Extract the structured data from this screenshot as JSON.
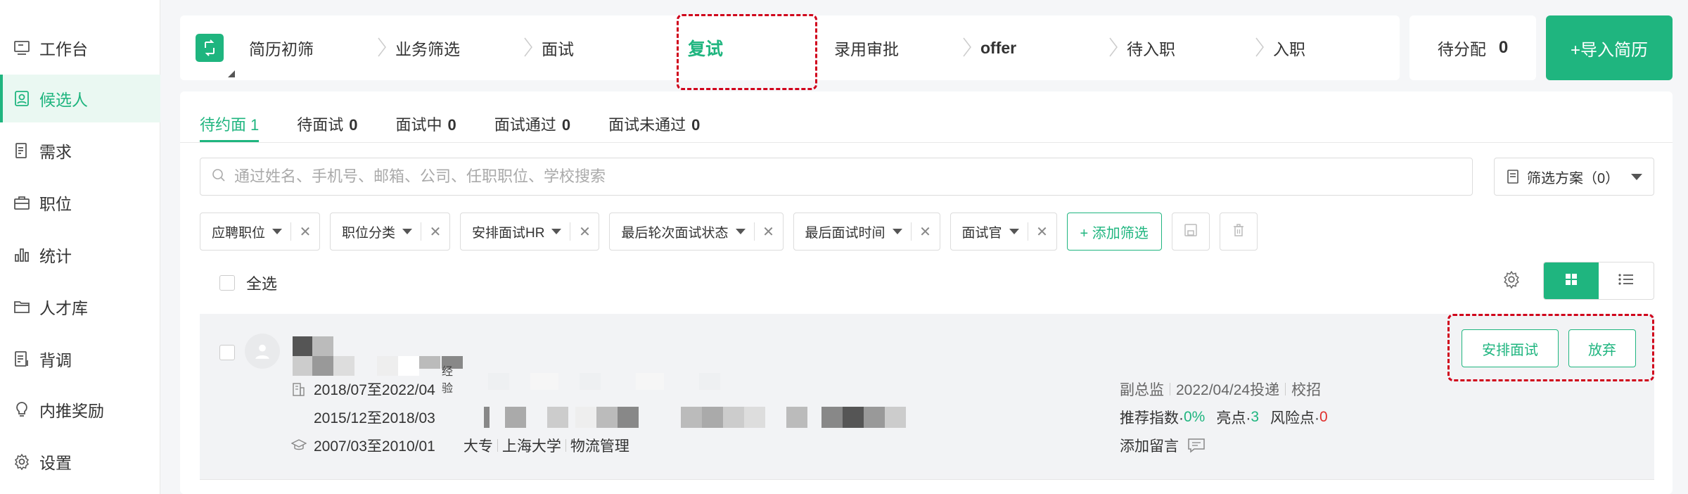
{
  "sidebar": {
    "items": [
      {
        "label": "工作台",
        "icon": "monitor-icon",
        "active": false
      },
      {
        "label": "候选人",
        "icon": "person-card-icon",
        "active": true
      },
      {
        "label": "需求",
        "icon": "document-icon",
        "active": false
      },
      {
        "label": "职位",
        "icon": "briefcase-icon",
        "active": false
      },
      {
        "label": "统计",
        "icon": "bar-chart-icon",
        "active": false
      },
      {
        "label": "人才库",
        "icon": "folder-icon",
        "active": false
      },
      {
        "label": "背调",
        "icon": "checklist-icon",
        "active": false
      },
      {
        "label": "内推奖励",
        "icon": "lightbulb-icon",
        "active": false
      },
      {
        "label": "设置",
        "icon": "gear-icon",
        "active": false
      }
    ]
  },
  "stages": [
    "简历初筛",
    "业务筛选",
    "面试",
    "复试",
    "录用审批",
    "offer",
    "待入职",
    "入职"
  ],
  "active_stage": "复试",
  "assign": {
    "label": "待分配",
    "count": "0"
  },
  "import_button": "+导入简历",
  "tabs": [
    {
      "label": "待约面",
      "count": "1",
      "active": true
    },
    {
      "label": "待面试",
      "count": "0",
      "active": false
    },
    {
      "label": "面试中",
      "count": "0",
      "active": false
    },
    {
      "label": "面试通过",
      "count": "0",
      "active": false
    },
    {
      "label": "面试未通过",
      "count": "0",
      "active": false
    }
  ],
  "search": {
    "placeholder": "通过姓名、手机号、邮箱、公司、任职职位、学校搜索",
    "value": ""
  },
  "filter_scheme": "筛选方案（0）",
  "filters": [
    "应聘职位",
    "职位分类",
    "安排面试HR",
    "最后轮次面试状态",
    "最后面试时间",
    "面试官"
  ],
  "add_filter": "+ 添加筛选",
  "select_all": "全选",
  "candidate": {
    "name_suffix": "经验",
    "work": [
      {
        "period": "2018/07至2022/04"
      },
      {
        "period": "2015/12至2018/03"
      }
    ],
    "education": {
      "period": "2007/03至2010/01",
      "degree": "大专",
      "school": "上海大学",
      "major": "物流管理"
    },
    "position": "副总监",
    "apply_date": "2022/04/24投递",
    "channel": "校招",
    "recommend_label": "推荐指数·",
    "recommend_value": "0%",
    "highlight_label": "亮点·",
    "highlight_value": "3",
    "risk_label": "风险点·",
    "risk_value": "0",
    "comment": "添加留言",
    "arrange_button": "安排面试",
    "abandon_button": "放弃"
  },
  "colors": {
    "accent": "#1fb57f",
    "annotation": "#d0021b",
    "risk": "#e0302d"
  }
}
